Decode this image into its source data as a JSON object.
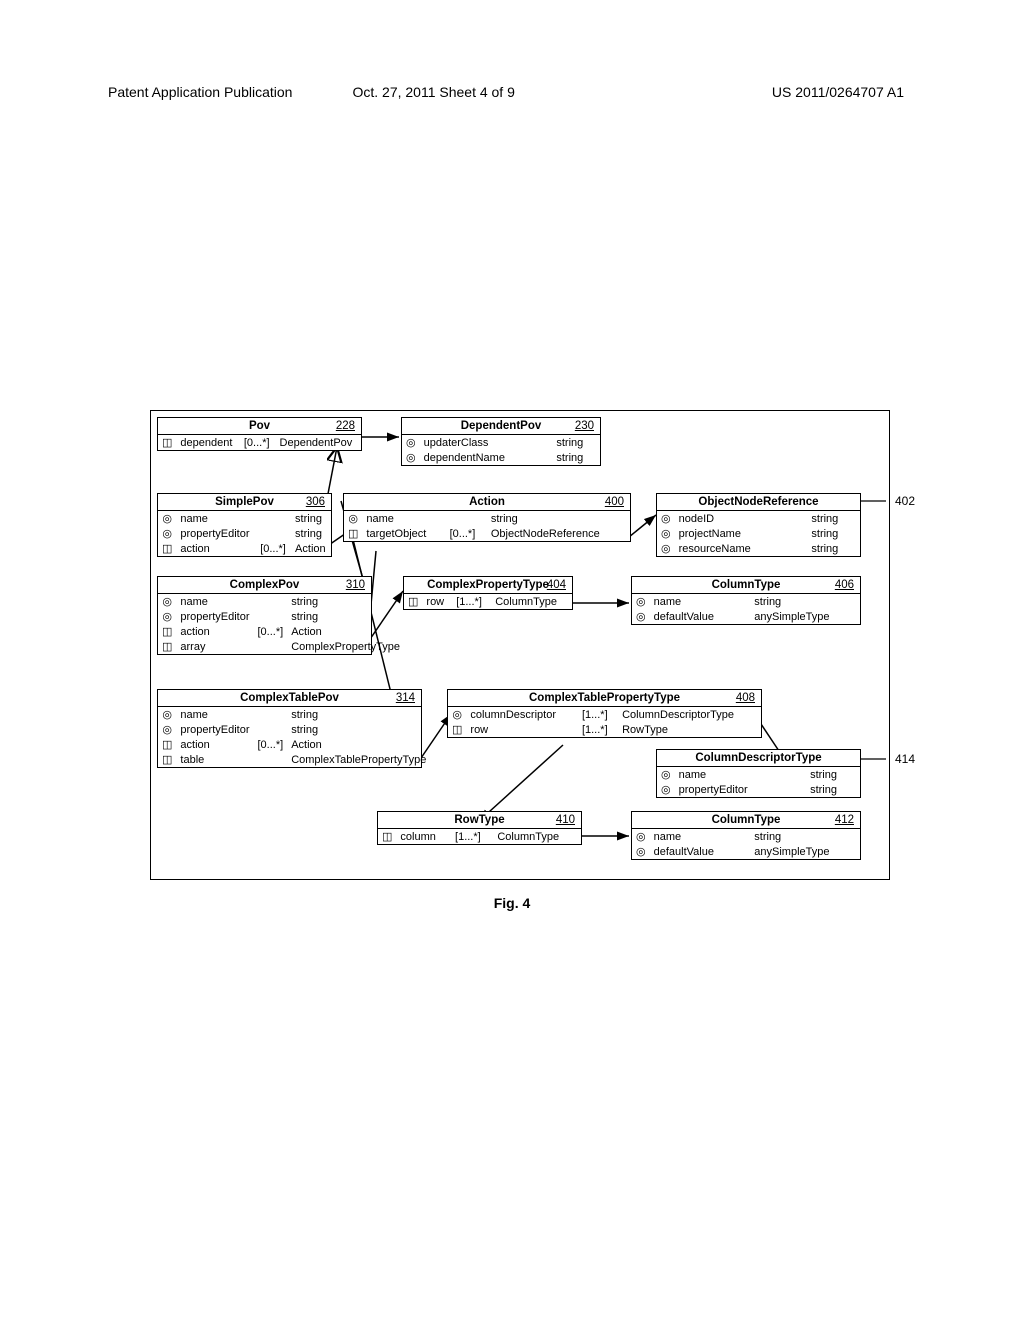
{
  "header": {
    "left": "Patent Application Publication",
    "center": "Oct. 27, 2011   Sheet 4 of 9",
    "right": "US 2011/0264707 A1"
  },
  "caption": "Fig. 4",
  "callouts": {
    "c402": "402",
    "c414": "414"
  },
  "boxes": {
    "pov": {
      "title": "Pov",
      "num": "228",
      "rows": [
        {
          "ic": "◫",
          "a": "dependent",
          "b": "[0...*]",
          "c": "DependentPov"
        }
      ]
    },
    "dependentPov": {
      "title": "DependentPov",
      "num": "230",
      "rows": [
        {
          "ic": "◎",
          "a": "updaterClass",
          "b": "",
          "c": "string"
        },
        {
          "ic": "◎",
          "a": "dependentName",
          "b": "",
          "c": "string"
        }
      ]
    },
    "simplePov": {
      "title": "SimplePov",
      "num": "306",
      "rows": [
        {
          "ic": "◎",
          "a": "name",
          "b": "",
          "c": "string"
        },
        {
          "ic": "◎",
          "a": "propertyEditor",
          "b": "",
          "c": "string"
        },
        {
          "ic": "◫",
          "a": "action",
          "b": "[0...*]",
          "c": "Action"
        }
      ]
    },
    "action": {
      "title": "Action",
      "num": "400",
      "rows": [
        {
          "ic": "◎",
          "a": "name",
          "b": "",
          "c": "string"
        },
        {
          "ic": "◫",
          "a": "targetObject",
          "b": "[0...*]",
          "c": "ObjectNodeReference"
        }
      ]
    },
    "objectNodeRef": {
      "title": "ObjectNodeReference",
      "num": "",
      "rows": [
        {
          "ic": "◎",
          "a": "nodeID",
          "b": "",
          "c": "string"
        },
        {
          "ic": "◎",
          "a": "projectName",
          "b": "",
          "c": "string"
        },
        {
          "ic": "◎",
          "a": "resourceName",
          "b": "",
          "c": "string"
        }
      ]
    },
    "complexPov": {
      "title": "ComplexPov",
      "num": "310",
      "rows": [
        {
          "ic": "◎",
          "a": "name",
          "b": "",
          "c": "string"
        },
        {
          "ic": "◎",
          "a": "propertyEditor",
          "b": "",
          "c": "string"
        },
        {
          "ic": "◫",
          "a": "action",
          "b": "[0...*]",
          "c": "Action"
        },
        {
          "ic": "◫",
          "a": "array",
          "b": "",
          "c": "ComplexPropertyType"
        }
      ]
    },
    "complexPropType": {
      "title": "ComplexPropertyType",
      "num": "404",
      "rows": [
        {
          "ic": "◫",
          "a": "row",
          "b": "[1...*]",
          "c": "ColumnType"
        }
      ]
    },
    "columnType1": {
      "title": "ColumnType",
      "num": "406",
      "rows": [
        {
          "ic": "◎",
          "a": "name",
          "b": "",
          "c": "string"
        },
        {
          "ic": "◎",
          "a": "defaultValue",
          "b": "",
          "c": "anySimpleType"
        }
      ]
    },
    "complexTablePov": {
      "title": "ComplexTablePov",
      "num": "314",
      "rows": [
        {
          "ic": "◎",
          "a": "name",
          "b": "",
          "c": "string"
        },
        {
          "ic": "◎",
          "a": "propertyEditor",
          "b": "",
          "c": "string"
        },
        {
          "ic": "◫",
          "a": "action",
          "b": "[0...*]",
          "c": "Action"
        },
        {
          "ic": "◫",
          "a": "table",
          "b": "",
          "c": "ComplexTablePropertyType"
        }
      ]
    },
    "complexTablePropType": {
      "title": "ComplexTablePropertyType",
      "num": "408",
      "rows": [
        {
          "ic": "◎",
          "a": "columnDescriptor",
          "b": "[1...*]",
          "c": "ColumnDescriptorType"
        },
        {
          "ic": "◫",
          "a": "row",
          "b": "[1...*]",
          "c": "RowType"
        }
      ]
    },
    "columnDescType": {
      "title": "ColumnDescriptorType",
      "num": "",
      "rows": [
        {
          "ic": "◎",
          "a": "name",
          "b": "",
          "c": "string"
        },
        {
          "ic": "◎",
          "a": "propertyEditor",
          "b": "",
          "c": "string"
        }
      ]
    },
    "rowType": {
      "title": "RowType",
      "num": "410",
      "rows": [
        {
          "ic": "◫",
          "a": "column",
          "b": "[1...*]",
          "c": "ColumnType"
        }
      ]
    },
    "columnType2": {
      "title": "ColumnType",
      "num": "412",
      "rows": [
        {
          "ic": "◎",
          "a": "name",
          "b": "",
          "c": "string"
        },
        {
          "ic": "◎",
          "a": "defaultValue",
          "b": "",
          "c": "anySimpleType"
        }
      ]
    }
  }
}
